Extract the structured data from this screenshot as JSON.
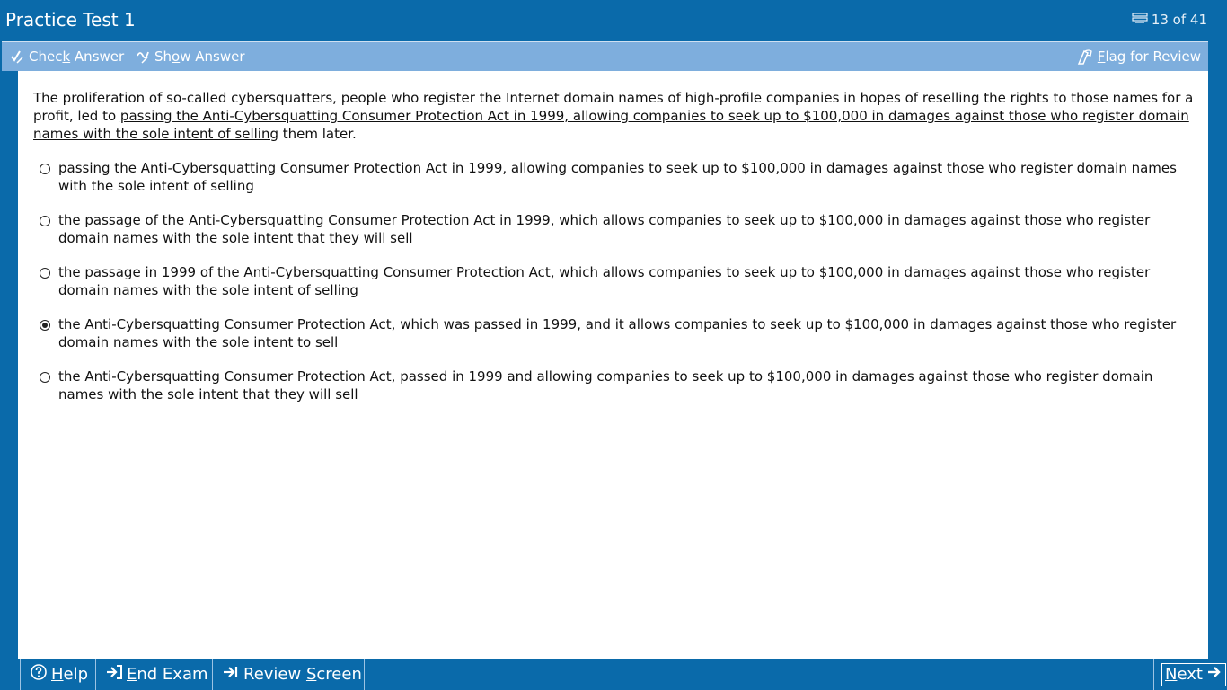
{
  "title_bar": {
    "title": "Practice Test 1",
    "progress": "13 of 41"
  },
  "toolbar": {
    "check_prefix": "Chec",
    "check_key": "k",
    "check_suffix": " Answer",
    "show_prefix": "Sh",
    "show_key": "o",
    "show_suffix": "w Answer",
    "flag_key": "F",
    "flag_suffix": "lag for Review"
  },
  "question": {
    "before": "The proliferation of so-called cybersquatters, people who register the Internet domain names of high-profile companies in hopes of reselling the rights to those names for a profit, led to ",
    "underlined": "passing the Anti-Cybersquatting Consumer Protection Act in 1999, allowing companies to seek up to $100,000 in damages against those who register domain names with the sole intent of selling",
    "after": " them later."
  },
  "options": [
    {
      "text": "passing the Anti-Cybersquatting Consumer Protection Act in 1999, allowing companies to seek up to $100,000 in damages against those who register domain names with the sole intent of selling",
      "selected": false
    },
    {
      "text": "the passage of the Anti-Cybersquatting Consumer Protection Act in 1999, which allows companies to seek up to $100,000 in damages against those who register domain names with the sole intent that they will sell",
      "selected": false
    },
    {
      "text": "the passage in 1999 of the Anti-Cybersquatting Consumer Protection Act, which allows companies to seek up to $100,000 in damages against those who register domain names with the sole intent of selling",
      "selected": false
    },
    {
      "text": "the Anti-Cybersquatting Consumer Protection Act, which was passed in 1999, and it allows companies to seek up to $100,000 in damages against those who register domain names with the sole intent to sell",
      "selected": true
    },
    {
      "text": "the Anti-Cybersquatting Consumer Protection Act, passed in 1999 and allowing companies to seek up to $100,000 in damages against those who register domain names with the sole intent that they will sell",
      "selected": false
    }
  ],
  "bottom_bar": {
    "help_key": "H",
    "help_suffix": "elp",
    "end_key": "E",
    "end_suffix": "nd Exam",
    "review_prefix": "Review ",
    "review_key": "S",
    "review_suffix": "creen",
    "next_key": "N",
    "next_suffix": "ext"
  },
  "colors": {
    "primary": "#0a6aaa",
    "toolbar": "#7eaedd",
    "content_bg": "#ffffff"
  },
  "icons": {
    "progress": "list-icon",
    "check": "check-pencil-icon",
    "show": "show-pencil-icon",
    "flag": "flag-pen-icon",
    "help": "question-circle-icon",
    "end": "exit-arrow-icon",
    "review": "arrow-bar-right-icon",
    "next": "arrow-right-icon"
  }
}
